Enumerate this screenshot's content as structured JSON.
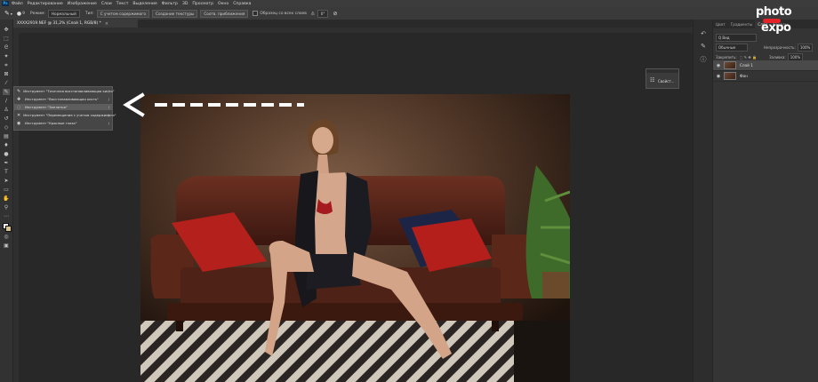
{
  "menubar": {
    "logo": "Ps",
    "items": [
      "Файл",
      "Редактирование",
      "Изображение",
      "Слои",
      "Текст",
      "Выделение",
      "Фильтр",
      "3D",
      "Просмотр",
      "Окно",
      "Справка"
    ]
  },
  "options": {
    "size_value": "9",
    "mode_label": "Режим:",
    "mode_value": "Нормальный",
    "type_label": "Тип:",
    "type_content_aware": "С учетом содержимого",
    "type_texture": "Создание текстуры",
    "type_proximity": "Соотв. приближения",
    "sample_all_layers": "Образец со всех слоев",
    "angle_value": "0°"
  },
  "document": {
    "tab_title": "XXXX2919.NEF @ 31,2% (Слой 1, RGB/8) *",
    "close": "×"
  },
  "flyout": {
    "items": [
      {
        "icon": "spot-healing-brush-icon",
        "label": "Инструмент \"Точечная восстанавливающая кисть\"",
        "key": "J"
      },
      {
        "icon": "healing-brush-icon",
        "label": "Инструмент \"Восстанавливающая кисть\"",
        "key": "J"
      },
      {
        "icon": "patch-icon",
        "label": "Инструмент \"Заплатка\"",
        "key": "J"
      },
      {
        "icon": "content-aware-move-icon",
        "label": "Инструмент \"Перемещение с учетом содержимого\"",
        "key": "J"
      },
      {
        "icon": "red-eye-icon",
        "label": "Инструмент \"Красные глаза\"",
        "key": "J"
      }
    ]
  },
  "mini_panel": {
    "label": "Свойст..."
  },
  "panel": {
    "tabs": [
      "Цвет",
      "Градиенты",
      "Слои",
      "Каналы"
    ],
    "active_tab": "Слои",
    "filter_label": "Q Вид",
    "blend_mode": "Обычные",
    "opacity_label": "Непрозрачность:",
    "opacity_value": "100%",
    "lock_label": "Закрепить:",
    "fill_label": "Заливка:",
    "fill_value": "100%",
    "layers": [
      {
        "name": "Слой 1",
        "selected": true
      },
      {
        "name": "Фон",
        "selected": false
      }
    ]
  },
  "watermark": {
    "line1": "photo",
    "line2": "expo"
  },
  "colors": {
    "accent": "#31a8ff",
    "watermark_red": "#e3242b",
    "arrow": "#ffffff"
  }
}
